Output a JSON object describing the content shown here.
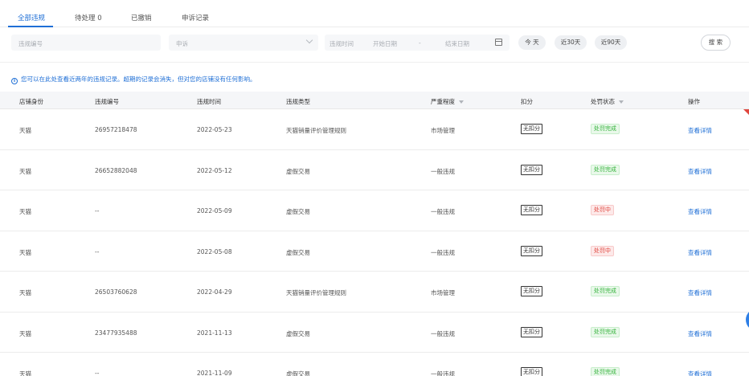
{
  "tabs": [
    {
      "label": "全部违规"
    },
    {
      "label": "待处理 0"
    },
    {
      "label": "已撤销"
    },
    {
      "label": "申诉记录"
    }
  ],
  "filters": {
    "violation_no_placeholder": "违规编号",
    "appeal_placeholder": "申诉",
    "time_label": "违规时间",
    "start_placeholder": "开始日期",
    "range_sep": "-",
    "end_placeholder": "结束日期",
    "today_label": "今 天",
    "last30_label": "近30天",
    "last90_label": "近90天",
    "search_label": "搜 索"
  },
  "notice": {
    "icon": "info-icon",
    "text": "您可以在此处查看近两年的违规记录。超期的记录会消失，但对您的店铺没有任何影响。"
  },
  "table": {
    "headers": {
      "identity": "店铺身份",
      "number": "违规编号",
      "time": "违规时间",
      "type": "违规类型",
      "severity": "严重程度",
      "deduct": "扣分",
      "status": "处罚状态",
      "action": "操作"
    },
    "rows": [
      {
        "identity": "天猫",
        "number": "26957218478",
        "time": "2022-05-23",
        "type": "天猫销量评价管理规则",
        "severity": "市场管理",
        "deduct": "无扣分",
        "status": "处罚完成",
        "status_kind": "done",
        "action": "查看详情"
      },
      {
        "identity": "天猫",
        "number": "26652882048",
        "time": "2022-05-12",
        "type": "虚假交易",
        "severity": "一般违规",
        "deduct": "无扣分",
        "status": "处罚完成",
        "status_kind": "done",
        "action": "查看详情"
      },
      {
        "identity": "天猫",
        "number": "--",
        "time": "2022-05-09",
        "type": "虚假交易",
        "severity": "一般违规",
        "deduct": "无扣分",
        "status": "处罚中",
        "status_kind": "pending",
        "action": "查看详情"
      },
      {
        "identity": "天猫",
        "number": "--",
        "time": "2022-05-08",
        "type": "虚假交易",
        "severity": "一般违规",
        "deduct": "无扣分",
        "status": "处罚中",
        "status_kind": "pending",
        "action": "查看详情"
      },
      {
        "identity": "天猫",
        "number": "26503760628",
        "time": "2022-04-29",
        "type": "天猫销量评价管理规则",
        "severity": "市场管理",
        "deduct": "无扣分",
        "status": "处罚完成",
        "status_kind": "done",
        "action": "查看详情"
      },
      {
        "identity": "天猫",
        "number": "23477935488",
        "time": "2021-11-13",
        "type": "虚假交易",
        "severity": "一般违规",
        "deduct": "无扣分",
        "status": "处罚完成",
        "status_kind": "done",
        "action": "查看详情"
      },
      {
        "identity": "天猫",
        "number": "--",
        "time": "2021-11-09",
        "type": "虚假交易",
        "severity": "一般违规",
        "deduct": "无扣分",
        "status": "处罚完成",
        "status_kind": "done",
        "action": "查看详情"
      }
    ]
  },
  "colors": {
    "accent": "#1f6fd6",
    "status_done": "#35b33c",
    "status_pending": "#e0473f"
  }
}
